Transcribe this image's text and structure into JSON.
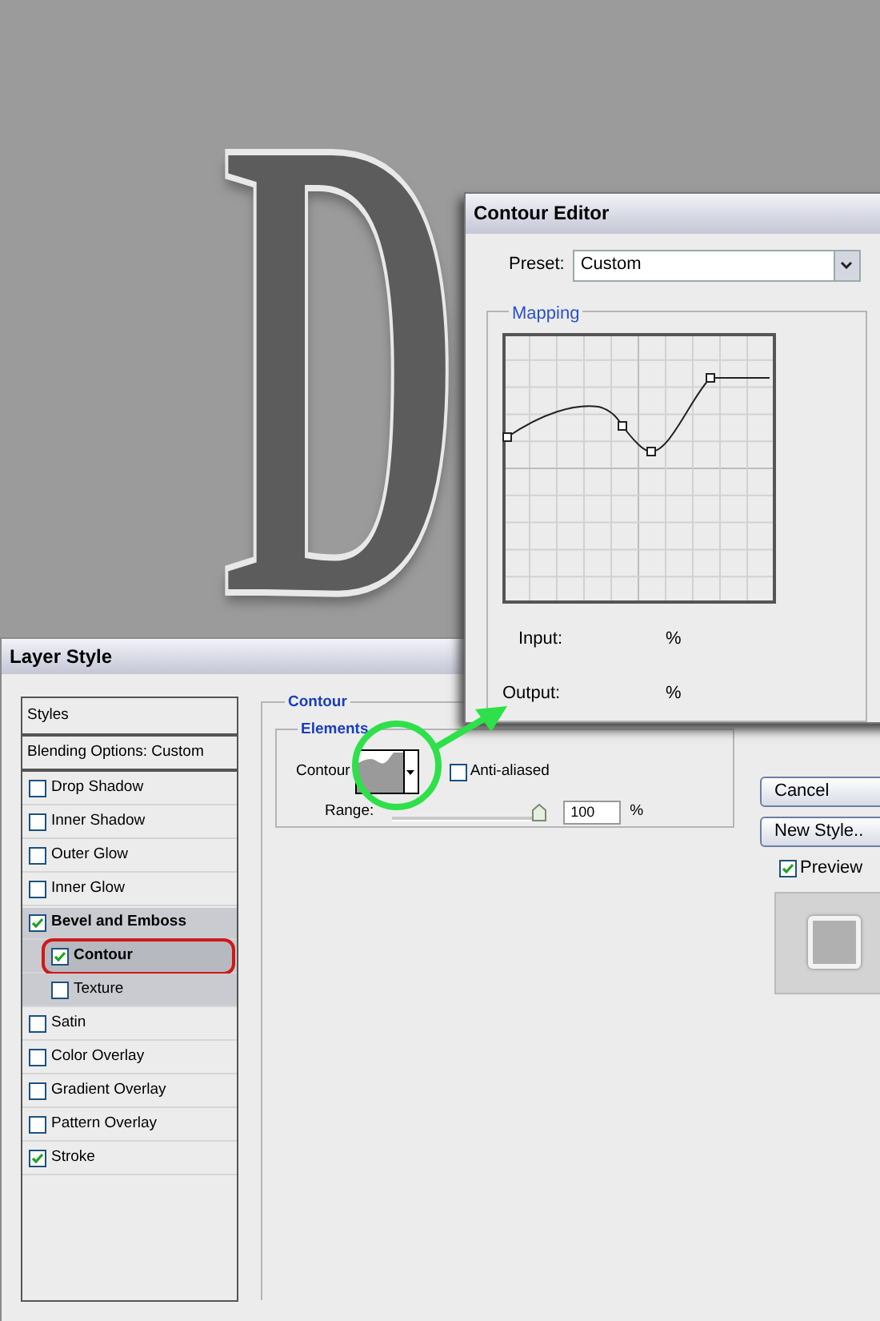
{
  "canvas": {
    "letter": "D"
  },
  "contour_editor": {
    "title": "Contour Editor",
    "preset_label": "Preset:",
    "preset_value": "Custom",
    "mapping_label": "Mapping",
    "input_label": "Input:",
    "input_unit": "%",
    "output_label": "Output:",
    "output_unit": "%"
  },
  "layer_style": {
    "title": "Layer Style",
    "styles_header": "Styles",
    "blending_options": "Blending Options: Custom",
    "effects": [
      {
        "label": "Drop Shadow",
        "checked": false,
        "selected": false
      },
      {
        "label": "Inner Shadow",
        "checked": false,
        "selected": false
      },
      {
        "label": "Outer Glow",
        "checked": false,
        "selected": false
      },
      {
        "label": "Inner Glow",
        "checked": false,
        "selected": false
      },
      {
        "label": "Bevel and Emboss",
        "checked": true,
        "selected": false,
        "expanded": true,
        "children": [
          {
            "label": "Contour",
            "checked": true,
            "selected": true
          },
          {
            "label": "Texture",
            "checked": false,
            "selected": false
          }
        ]
      },
      {
        "label": "Satin",
        "checked": false,
        "selected": false
      },
      {
        "label": "Color Overlay",
        "checked": false,
        "selected": false
      },
      {
        "label": "Gradient Overlay",
        "checked": false,
        "selected": false
      },
      {
        "label": "Pattern Overlay",
        "checked": false,
        "selected": false
      },
      {
        "label": "Stroke",
        "checked": true,
        "selected": false
      }
    ],
    "contour_section": {
      "title": "Contour",
      "elements_title": "Elements",
      "contour_label": "Contour",
      "anti_aliased": {
        "label": "Anti-aliased",
        "checked": false
      },
      "range_label": "Range:",
      "range": {
        "level": 1.0
      },
      "range_value": "100",
      "range_unit": "%"
    },
    "buttons": [
      {
        "label": "Cancel"
      },
      {
        "label": "New Style.."
      }
    ],
    "preview": {
      "label": "Preview",
      "checked": true
    }
  }
}
